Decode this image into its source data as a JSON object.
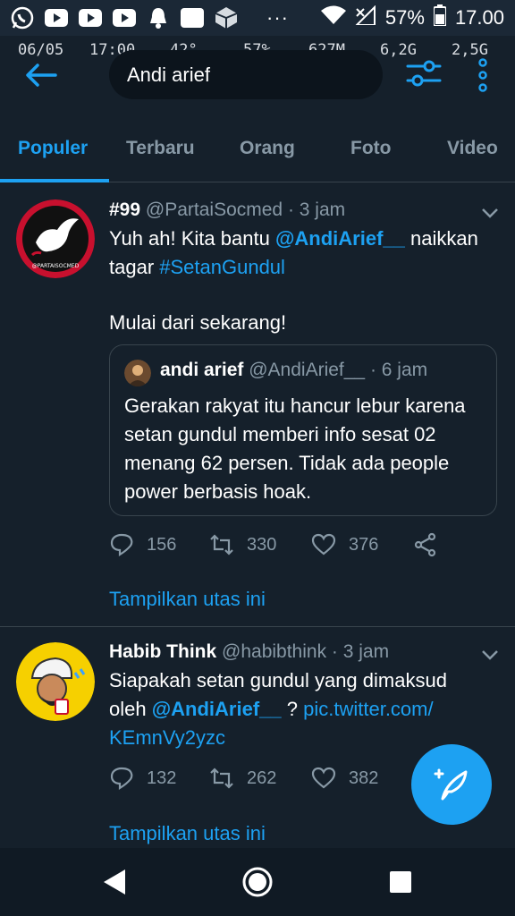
{
  "status_bar": {
    "battery": "57%",
    "time": "17.00",
    "more": "···"
  },
  "monitor": {
    "date": "06/05",
    "time": "17:00",
    "temp": "42°",
    "battery": "57%",
    "ram": "627M",
    "storage1": "6,2G",
    "storage2": "2,5G"
  },
  "header": {
    "search_value": "Andi arief"
  },
  "tabs": [
    {
      "label": "Populer"
    },
    {
      "label": "Terbaru"
    },
    {
      "label": "Orang"
    },
    {
      "label": "Foto"
    },
    {
      "label": "Video"
    }
  ],
  "tweets": [
    {
      "name": "#99",
      "handle": "@PartaiSocmed",
      "time": "· 3 jam",
      "body_1": "Yuh ah! Kita bantu ",
      "mention": "@AndiArief__",
      "body_2": " naikkan tagar ",
      "hashtag": "#SetanGundul",
      "body_3": "Mulai dari sekarang!",
      "avatar_caption": "@PARTAISOCMED",
      "quote": {
        "name": "andi arief",
        "handle": "@AndiArief__",
        "time": "· 6 jam",
        "text": "Gerakan rakyat itu hancur lebur karena setan gundul memberi info sesat 02 menang 62 persen. Tidak ada people power berbasis hoak."
      },
      "replies": "156",
      "retweets": "330",
      "likes": "376",
      "thread_link": "Tampilkan utas ini"
    },
    {
      "name": "Habib Think",
      "handle": "@habibthink",
      "time": "· 3 jam",
      "body_1": "Siapakah setan gundul yang dimaksud oleh ",
      "mention": "@AndiArief__",
      "body_2": " ? ",
      "pic_link_1": "pic.twitter.com/",
      "pic_link_2": "KEmnVy2yzc",
      "replies": "132",
      "retweets": "262",
      "likes": "382",
      "thread_link": "Tampilkan utas ini"
    }
  ],
  "colors": {
    "background": "#15202b",
    "accent": "#1da1f2",
    "muted": "#8899a6",
    "divider": "#38444d"
  }
}
